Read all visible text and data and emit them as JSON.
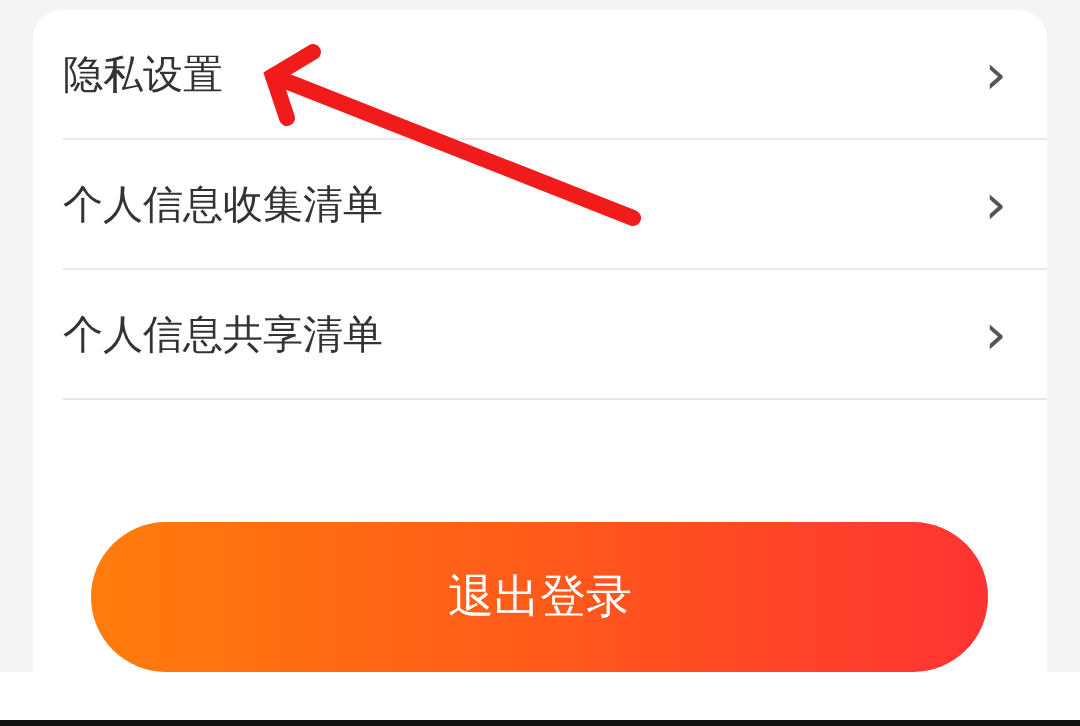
{
  "menu": [
    {
      "label": "隐私设置",
      "chevron": "›"
    },
    {
      "label": "个人信息收集清单",
      "chevron": "›"
    },
    {
      "label": "个人信息共享清单",
      "chevron": "›"
    }
  ],
  "logout_button": {
    "label": "退出登录"
  },
  "annotation": {
    "kind": "arrow"
  }
}
